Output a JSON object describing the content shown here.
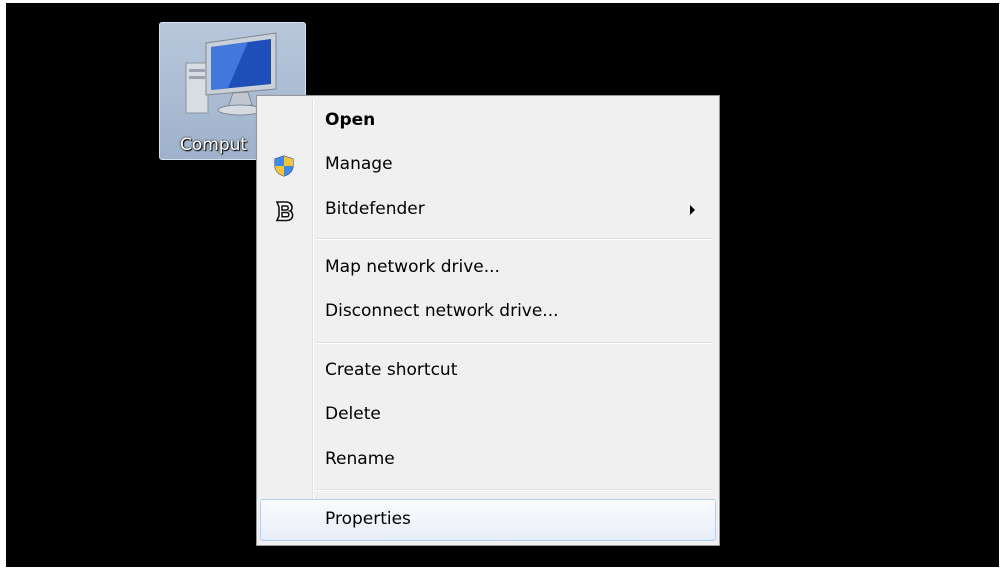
{
  "desktop": {
    "icon_label": "Comput",
    "background": "#000000"
  },
  "context_menu": {
    "items": [
      {
        "label": "Open",
        "bold": true
      },
      {
        "label": "Manage",
        "icon": "uac-shield-icon"
      },
      {
        "label": "Bitdefender",
        "icon": "bitdefender-icon",
        "submenu": true
      },
      {
        "label": "Map network drive..."
      },
      {
        "label": "Disconnect network drive..."
      },
      {
        "label": "Create shortcut"
      },
      {
        "label": "Delete"
      },
      {
        "label": "Rename"
      },
      {
        "label": "Properties",
        "highlighted": true
      }
    ],
    "hover_border": "#aecff7",
    "background": "#f0f0f0"
  }
}
